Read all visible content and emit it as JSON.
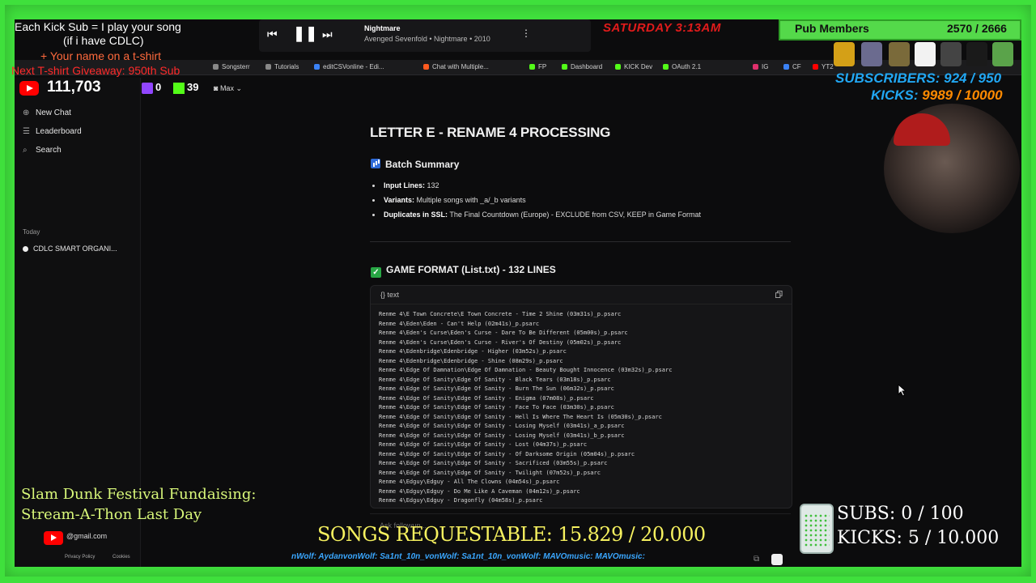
{
  "overlay": {
    "kick_sub_line1": "Each Kick Sub = I play your song",
    "kick_sub_line2": "(if i have CDLC)",
    "kick_sub_line3": "+ Your name on a t-shirt",
    "giveaway": "Next T-shirt Giveaway: 950th Sub",
    "yt_count": "111,703",
    "twitch_count": "0",
    "kick_count": "39",
    "clock": "SATURDAY 3:13AM",
    "pub_members_label": "Pub Members",
    "pub_members_count": "2570 / 2666",
    "subscribers": "SUBSCRIBERS: 924 / 950",
    "kicks_label": "KICKS: ",
    "kicks_value": "9989 / 10000",
    "fundraise_line1": "Slam Dunk Festival Fundaising:",
    "fundraise_line2": "Stream-A-Thon Last Day",
    "email": "@gmail.com",
    "privacy": "Privacy Policy",
    "cookies": "Cookies",
    "songs_requestable": "SONGS REQUESTABLE: 15.829 / 20.000",
    "ticker": "nWolf:  AydanvonWolf:  Sa1nt_10n_vonWolf:  Sa1nt_10n_vonWolf:  MAVOmusic:  MAVOmusic:",
    "subs_goal": "SUBS:  0 / 100",
    "kicks_goal": "KICKS: 5 / 10.000",
    "colors": {
      "screen_green": "#3fe03c",
      "clock_red": "#e01b1b",
      "subs_blue": "#21a7f3",
      "kicks_orange": "#ff8a00",
      "songs_yellow": "#f6f15f"
    }
  },
  "player": {
    "title": "Nightmare",
    "subtitle": "Avenged Sevenfold • Nightmare • 2010"
  },
  "browser": {
    "bookmarks": [
      "Songsterr",
      "Tutorials",
      "editCSVonline - Edi...",
      "Chat with Multiple...",
      "FP",
      "Dashboard",
      "KICK Dev",
      "OAuth 2.1",
      "IG",
      "CF",
      "YT2"
    ],
    "model_label": "Max"
  },
  "sidebar": {
    "new_chat": "New Chat",
    "leaderboard": "Leaderboard",
    "search": "Search",
    "today_label": "Today",
    "history_item": "CDLC SMART ORGANI..."
  },
  "doc": {
    "title": "LETTER E - RENAME 4 PROCESSING",
    "batch_heading": "Batch Summary",
    "bullets": [
      {
        "label": "Input Lines:",
        "value": "132"
      },
      {
        "label": "Variants:",
        "value": "Multiple songs with _a/_b variants"
      },
      {
        "label": "Duplicates in SSL:",
        "value": "The Final Countdown (Europe) - EXCLUDE from CSV, KEEP in Game Format"
      }
    ],
    "game_format_heading": "GAME FORMAT (List.txt) - 132 LINES",
    "code_lang": "text",
    "code_lines": [
      "Renme 4\\E Town Concrete\\E Town Concrete - Time 2 Shine (03m31s)_p.psarc",
      "Renme 4\\Eden\\Eden - Can't Help (02m41s)_p.psarc",
      "Renme 4\\Eden's Curse\\Eden's Curse - Dare To Be Different (05m00s)_p.psarc",
      "Renme 4\\Eden's Curse\\Eden's Curse - River's Of Destiny (05m02s)_p.psarc",
      "Renme 4\\Edenbridge\\Edenbridge - Higher (03m52s)_p.psarc",
      "Renme 4\\Edenbridge\\Edenbridge - Shine (08m29s)_p.psarc",
      "Renme 4\\Edge Of Damnation\\Edge Of Damnation - Beauty Bought Innocence (03m32s)_p.psarc",
      "Renme 4\\Edge Of Sanity\\Edge Of Sanity - Black Tears (03m18s)_p.psarc",
      "Renme 4\\Edge Of Sanity\\Edge Of Sanity - Burn The Sun (06m32s)_p.psarc",
      "Renme 4\\Edge Of Sanity\\Edge Of Sanity - Enigma (07m08s)_p.psarc",
      "Renme 4\\Edge Of Sanity\\Edge Of Sanity - Face To Face (03m30s)_p.psarc",
      "Renme 4\\Edge Of Sanity\\Edge Of Sanity - Hell Is Where The Heart Is (05m30s)_p.psarc",
      "Renme 4\\Edge Of Sanity\\Edge Of Sanity - Losing Myself (03m41s)_a_p.psarc",
      "Renme 4\\Edge Of Sanity\\Edge Of Sanity - Losing Myself (03m41s)_b_p.psarc",
      "Renme 4\\Edge Of Sanity\\Edge Of Sanity - Lost (04m37s)_p.psarc",
      "Renme 4\\Edge Of Sanity\\Edge Of Sanity - Of Darksome Origin (05m04s)_p.psarc",
      "Renme 4\\Edge Of Sanity\\Edge Of Sanity - Sacrificed (03m55s)_p.psarc",
      "Renme 4\\Edge Of Sanity\\Edge Of Sanity - Twilight (07m52s)_p.psarc",
      "Renme 4\\Edguy\\Edguy - All The Clowns (04m54s)_p.psarc",
      "Renme 4\\Edguy\\Edguy - Do Me Like A Caveman (04m12s)_p.psarc",
      "Renme 4\\Edguy\\Edguy - Dragonfly (04m58s)_p.psarc"
    ],
    "followup_placeholder": "Ask followup..."
  }
}
